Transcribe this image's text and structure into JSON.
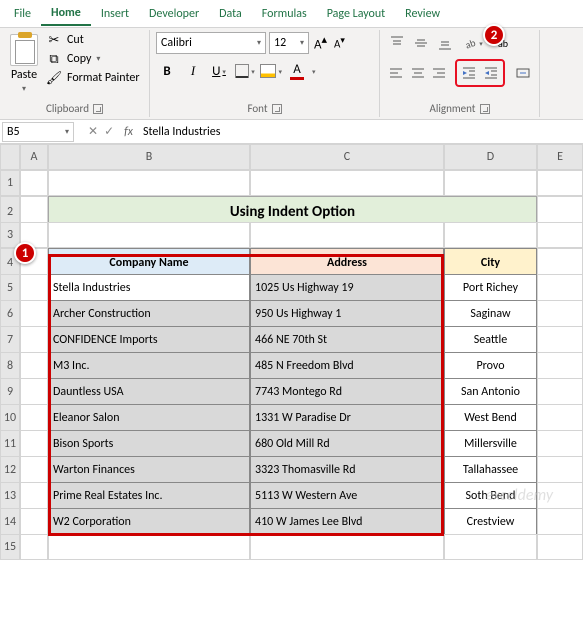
{
  "tabs": [
    "File",
    "Home",
    "Insert",
    "Developer",
    "Data",
    "Formulas",
    "Page Layout",
    "Review"
  ],
  "active_tab": "Home",
  "clipboard": {
    "paste": "Paste",
    "cut": "Cut",
    "copy": "Copy",
    "painter": "Format Painter",
    "label": "Clipboard"
  },
  "font": {
    "name": "Calibri",
    "size": "12",
    "grow": "A",
    "shrink": "A",
    "bold": "B",
    "italic": "I",
    "underline": "U",
    "color": "A",
    "label": "Font"
  },
  "alignment": {
    "label": "Alignment",
    "wrap": "ab",
    "merge": "M"
  },
  "namebox": "B5",
  "formula_value": "Stella Industries",
  "columns": [
    "",
    "A",
    "B",
    "C",
    "D",
    "E"
  ],
  "title": "Using Indent Option",
  "headers": {
    "b": "Company Name",
    "c": "Address",
    "d": "City"
  },
  "rows": [
    {
      "b": "Stella Industries",
      "c": "1025 Us Highway 19",
      "d": "Port Richey"
    },
    {
      "b": "Archer Construction",
      "c": "950 Us Highway 1",
      "d": "Saginaw"
    },
    {
      "b": "CONFIDENCE Imports",
      "c": "466 NE 70th St",
      "d": "Seattle"
    },
    {
      "b": "M3 Inc.",
      "c": "485 N Freedom Blvd",
      "d": "Provo"
    },
    {
      "b": "Dauntless USA",
      "c": "7743 Montego Rd",
      "d": "San Antonio"
    },
    {
      "b": "Eleanor Salon",
      "c": "1331 W Paradise Dr",
      "d": "West Bend"
    },
    {
      "b": "Bison Sports",
      "c": "680 Old Mill Rd",
      "d": "Millersville"
    },
    {
      "b": "Warton Finances",
      "c": "3323 Thomasville Rd",
      "d": "Tallahassee"
    },
    {
      "b": "Prime Real Estates Inc.",
      "c": "5113 W Western Ave",
      "d": "Soth Bend"
    },
    {
      "b": "W2 Corporation",
      "c": "410 W James Lee Blvd",
      "d": "Crestview"
    }
  ],
  "callouts": {
    "one": "1",
    "two": "2"
  },
  "watermark": "exceldemy"
}
